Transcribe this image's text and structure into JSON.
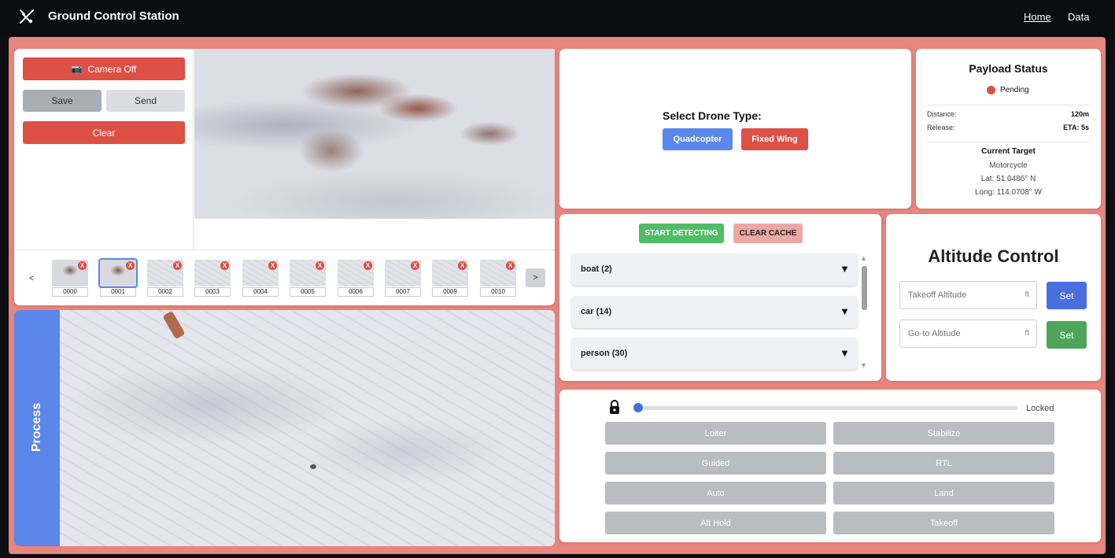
{
  "nav": {
    "title": "Ground Control Station",
    "links": [
      "Home",
      "Data"
    ]
  },
  "camera": {
    "camera_button": "Camera Off",
    "save": "Save",
    "send": "Send",
    "clear": "Clear"
  },
  "thumbnails": {
    "prev": "<",
    "next": ">",
    "delete_symbol": "X",
    "items": [
      "0000",
      "0001",
      "0002",
      "0003",
      "0004",
      "0005",
      "0006",
      "0007",
      "0009",
      "0010"
    ]
  },
  "process": {
    "label": "Process"
  },
  "drone_type": {
    "title": "Select Drone Type:",
    "options": [
      "Quadcopter",
      "Fixed Wing"
    ]
  },
  "payload": {
    "title": "Payload Status",
    "status": "Pending",
    "status_color": "#dc5046",
    "distance_label": "Distance:",
    "distance_value": "120m",
    "release_label": "Release:",
    "release_value": "ETA: 5s",
    "target_title": "Current Target",
    "target_name": "Motorcycle",
    "lat": "Lat: 51.0486° N",
    "long": "Long: 114.0708° W"
  },
  "detection": {
    "start": "START DETECTING",
    "clear_cache": "CLEAR CACHE",
    "items": [
      {
        "label": "boat (2)"
      },
      {
        "label": "car (14)"
      },
      {
        "label": "person (30)"
      }
    ]
  },
  "altitude": {
    "title": "Altitude Control",
    "takeoff_placeholder": "Takeoff Altitude",
    "goto_placeholder": "Go-to Altitude",
    "unit": "ft",
    "set": "Set"
  },
  "modes": {
    "lock_status": "Locked",
    "slider_value": 0,
    "buttons": [
      "Loiter",
      "Stabilize",
      "Guided",
      "RTL",
      "Auto",
      "Land",
      "Alt Hold",
      "Takeoff"
    ]
  },
  "colors": {
    "accent_red": "#dc5046",
    "accent_blue": "#5b86ea",
    "accent_green": "#4ea55a",
    "frame": "#e8857c"
  }
}
